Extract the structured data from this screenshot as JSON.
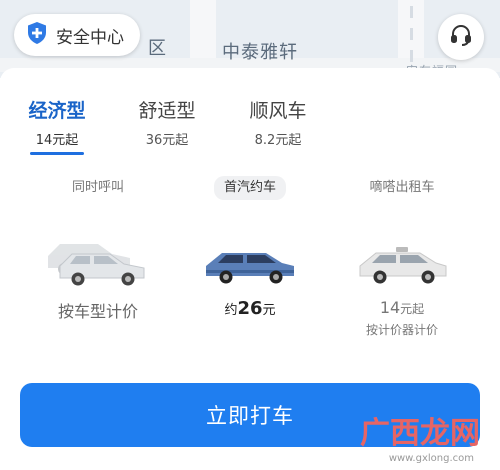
{
  "map": {
    "labels": [
      "区",
      "中泰雅轩"
    ],
    "faded_label": "安车福园"
  },
  "safety_center": {
    "label": "安全中心",
    "icon": "shield-plus-icon"
  },
  "support": {
    "icon": "headset-icon"
  },
  "tabs": [
    {
      "label": "经济型",
      "price": "14元起",
      "active": true
    },
    {
      "label": "舒适型",
      "price": "36元起",
      "active": false
    },
    {
      "label": "顺风车",
      "price": "8.2元起",
      "active": false
    }
  ],
  "options": [
    {
      "tag": "同时呼叫",
      "main": "按车型计价",
      "sub": ""
    },
    {
      "tag": "首汽约车",
      "main_prefix": "约",
      "main_value": "26",
      "main_unit": "元",
      "highlighted": true
    },
    {
      "tag": "嘀嗒出租车",
      "main_value": "14",
      "main_unit": "元起",
      "sub": "按计价器计价"
    }
  ],
  "cta": {
    "label": "立即打车"
  },
  "watermark": {
    "text": "广西龙网",
    "domain": "www.gxlong.com"
  },
  "colors": {
    "accent": "#1f7ef0",
    "active_tab": "#1a64c8",
    "shield": "#2f7ae5"
  }
}
